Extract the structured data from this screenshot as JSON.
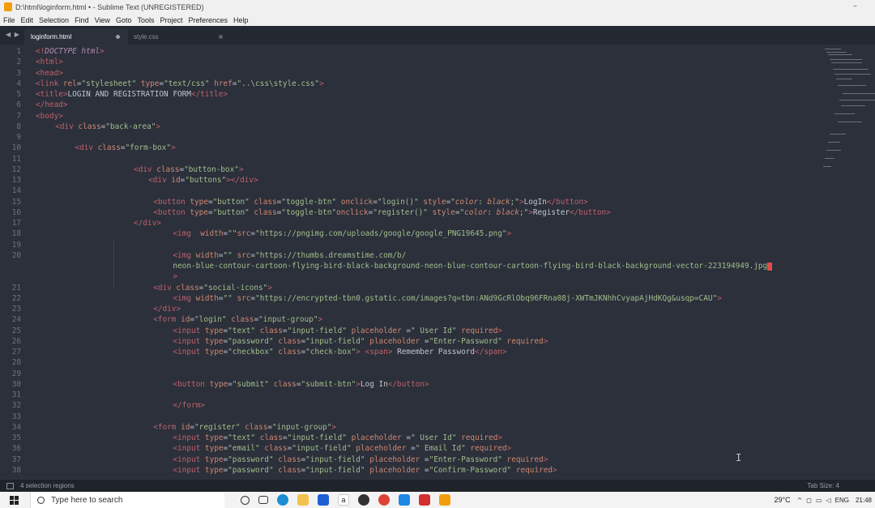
{
  "window": {
    "title": "D:\\html\\loginform.html • - Sublime Text (UNREGISTERED)",
    "minimize_glyph": "–"
  },
  "menu": [
    "File",
    "Edit",
    "Selection",
    "Find",
    "View",
    "Goto",
    "Tools",
    "Project",
    "Preferences",
    "Help"
  ],
  "tabs": [
    {
      "label": "loginform.html",
      "active": true
    },
    {
      "label": "style.css",
      "active": false
    }
  ],
  "nav_arrows": "◀ ▶",
  "editor": {
    "lines": [
      {
        "n": "1",
        "indent": 0,
        "html": "<span class=\"tg\">&lt;!</span><span class=\"kw\">DOCTYPE html</span><span class=\"tg\">&gt;</span>"
      },
      {
        "n": "2",
        "indent": 0,
        "html": "<span class=\"tg\">&lt;html&gt;</span>"
      },
      {
        "n": "3",
        "indent": 0,
        "html": "<span class=\"tg\">&lt;head&gt;</span>"
      },
      {
        "n": "4",
        "indent": 0,
        "html": "<span class=\"tg\">&lt;link</span> <span class=\"at\">rel</span>=<span class=\"st\">\"stylesheet\"</span> <span class=\"at\">type</span>=<span class=\"st\">\"text/css\"</span> <span class=\"at\">href</span>=<span class=\"st\">\"..\\css\\style.css\"</span><span class=\"tg\">&gt;</span>"
      },
      {
        "n": "5",
        "indent": 0,
        "html": "<span class=\"tg\">&lt;title&gt;</span>LOGIN AND REGISTRATION FORM<span class=\"tg\">&lt;/title&gt;</span>"
      },
      {
        "n": "6",
        "indent": 0,
        "html": "<span class=\"tg\">&lt;/head&gt;</span>"
      },
      {
        "n": "7",
        "indent": 0,
        "html": "<span class=\"tg\">&lt;body&gt;</span>"
      },
      {
        "n": "8",
        "indent": 4,
        "html": "<span class=\"tg\">&lt;div</span> <span class=\"at\">class</span>=<span class=\"st\">\"back-area\"</span><span class=\"tg\">&gt;</span>"
      },
      {
        "n": "9",
        "indent": 0,
        "html": ""
      },
      {
        "n": "10",
        "indent": 8,
        "html": "<span class=\"tg\">&lt;div</span> <span class=\"at\">class</span>=<span class=\"st\">\"form-box\"</span><span class=\"tg\">&gt;</span>"
      },
      {
        "n": "11",
        "indent": 0,
        "html": ""
      },
      {
        "n": "12",
        "indent": 20,
        "html": "<span class=\"tg\">&lt;div</span> <span class=\"at\">class</span>=<span class=\"st\">\"button-box\"</span><span class=\"tg\">&gt;</span>"
      },
      {
        "n": "13",
        "indent": 23,
        "html": "<span class=\"tg\">&lt;div</span> <span class=\"at\">id</span>=<span class=\"st\">\"buttons\"</span><span class=\"tg\">&gt;&lt;/div&gt;</span>"
      },
      {
        "n": "14",
        "indent": 0,
        "html": ""
      },
      {
        "n": "15",
        "indent": 24,
        "html": "<span class=\"tg\">&lt;button</span> <span class=\"at\">type</span>=<span class=\"st\">\"button\"</span> <span class=\"at\">class</span>=<span class=\"st\">\"toggle-btn\"</span> <span class=\"at\">onclick</span>=<span class=\"st\">\"login()\"</span> <span class=\"at\">style</span>=<span class=\"st\">\"<span class=\"it\">color</span>: <span class=\"it\">black</span>;\"</span><span class=\"tg\">&gt;</span>LogIn<span class=\"tg\">&lt;/button&gt;</span>"
      },
      {
        "n": "16",
        "indent": 24,
        "html": "<span class=\"tg\">&lt;button</span> <span class=\"at\">type</span>=<span class=\"st\">\"button\"</span> <span class=\"at\">class</span>=<span class=\"st\">\"toggle-btn\"</span><span class=\"at\">onclick</span>=<span class=\"st\">\"register()\"</span> <span class=\"at\">style</span>=<span class=\"st\">\"<span class=\"it\">color</span>: <span class=\"it\">black</span>;\"</span><span class=\"tg\">&gt;</span>Register<span class=\"tg\">&lt;/button&gt;</span>"
      },
      {
        "n": "17",
        "indent": 20,
        "html": "<span class=\"tg\">&lt;/div&gt;</span>"
      },
      {
        "n": "18",
        "indent": 28,
        "html": "<span class=\"tg\">&lt;img</span>  <span class=\"at\">width</span>=<span class=\"st\">\"\"</span><span class=\"at\">src</span>=<span class=\"st\">\"https://pngimg.com/uploads/google/google_PNG19645.png\"</span><span class=\"tg\">&gt;</span>"
      },
      {
        "n": "19",
        "indent": 0,
        "html": ""
      },
      {
        "n": "20",
        "indent": 28,
        "html": "<span class=\"tg\">&lt;img</span> <span class=\"at\">width</span>=<span class=\"st\">\"\"</span> <span class=\"at\">src</span>=<span class=\"st\">\"https://thumbs.dreamstime.com/b/</span>"
      },
      {
        "n": "",
        "indent": 28,
        "html": "<span class=\"st\">neon-blue-contour-cartoon-flying-bird-black-background-neon-blue-contour-cartoon-flying-bird-black-background-vector-223194949.jpg<span class=\"caret\"></span></span>"
      },
      {
        "n": "",
        "indent": 28,
        "html": "<span class=\"tg\">&gt;</span>"
      },
      {
        "n": "21",
        "indent": 24,
        "html": "<span class=\"tg\">&lt;div</span> <span class=\"at\">class</span>=<span class=\"st\">\"social-icons\"</span><span class=\"tg\">&gt;</span>"
      },
      {
        "n": "22",
        "indent": 28,
        "html": "<span class=\"tg\">&lt;img</span> <span class=\"at\">width</span>=<span class=\"st\">\"\"</span> <span class=\"at\">src</span>=<span class=\"st\">\"https://encrypted-tbn0.gstatic.com/images?q=tbn:ANd9GcRlObq96FRna08j-XWTmJKNhhCvyapAjHdKQg&amp;usqp=CAU\"</span><span class=\"tg\">&gt;</span>"
      },
      {
        "n": "23",
        "indent": 24,
        "html": "<span class=\"tg\">&lt;/div&gt;</span>"
      },
      {
        "n": "24",
        "indent": 24,
        "html": "<span class=\"tg\">&lt;form</span> <span class=\"at\">id</span>=<span class=\"st\">\"login\"</span> <span class=\"at\">class</span>=<span class=\"st\">\"input-group\"</span><span class=\"tg\">&gt;</span>"
      },
      {
        "n": "25",
        "indent": 28,
        "html": "<span class=\"tg\">&lt;input</span> <span class=\"at\">type</span>=<span class=\"st\">\"text\"</span> <span class=\"at\">class</span>=<span class=\"st\">\"input-field\"</span> <span class=\"at\">placeholder</span> =<span class=\"st\">\" User Id\"</span> <span class=\"at\">required</span><span class=\"tg\">&gt;</span>"
      },
      {
        "n": "26",
        "indent": 28,
        "html": "<span class=\"tg\">&lt;input</span> <span class=\"at\">type</span>=<span class=\"st\">\"password\"</span> <span class=\"at\">class</span>=<span class=\"st\">\"input-field\"</span> <span class=\"at\">placeholder</span> =<span class=\"st\">\"Enter-Password\"</span> <span class=\"at\">required</span><span class=\"tg\">&gt;</span>"
      },
      {
        "n": "27",
        "indent": 28,
        "html": "<span class=\"tg\">&lt;input</span> <span class=\"at\">type</span>=<span class=\"st\">\"checkbox\"</span> <span class=\"at\">class</span>=<span class=\"st\">\"check-box\"</span><span class=\"tg\">&gt;</span> <span class=\"tg\">&lt;span&gt;</span> Remember Password<span class=\"tg\">&lt;/span&gt;</span>"
      },
      {
        "n": "28",
        "indent": 0,
        "html": ""
      },
      {
        "n": "29",
        "indent": 0,
        "html": ""
      },
      {
        "n": "30",
        "indent": 28,
        "html": "<span class=\"tg\">&lt;button</span> <span class=\"at\">type</span>=<span class=\"st\">\"submit\"</span> <span class=\"at\">class</span>=<span class=\"st\">\"submit-btn\"</span><span class=\"tg\">&gt;</span>Log In<span class=\"tg\">&lt;/button&gt;</span>"
      },
      {
        "n": "31",
        "indent": 0,
        "html": ""
      },
      {
        "n": "32",
        "indent": 28,
        "html": "<span class=\"tg\">&lt;/form&gt;</span>"
      },
      {
        "n": "33",
        "indent": 0,
        "html": ""
      },
      {
        "n": "34",
        "indent": 24,
        "html": "<span class=\"tg\">&lt;form</span> <span class=\"at\">id</span>=<span class=\"st\">\"register\"</span> <span class=\"at\">class</span>=<span class=\"st\">\"input-group\"</span><span class=\"tg\">&gt;</span>"
      },
      {
        "n": "35",
        "indent": 28,
        "html": "<span class=\"tg\">&lt;input</span> <span class=\"at\">type</span>=<span class=\"st\">\"text\"</span> <span class=\"at\">class</span>=<span class=\"st\">\"input-field\"</span> <span class=\"at\">placeholder</span> =<span class=\"st\">\" User Id\"</span> <span class=\"at\">required</span><span class=\"tg\">&gt;</span>"
      },
      {
        "n": "36",
        "indent": 28,
        "html": "<span class=\"tg\">&lt;input</span> <span class=\"at\">type</span>=<span class=\"st\">\"email\"</span> <span class=\"at\">class</span>=<span class=\"st\">\"input-field\"</span> <span class=\"at\">placeholder</span> =<span class=\"st\">\" Email Id\"</span> <span class=\"at\">required</span><span class=\"tg\">&gt;</span>"
      },
      {
        "n": "37",
        "indent": 28,
        "html": "<span class=\"tg\">&lt;input</span> <span class=\"at\">type</span>=<span class=\"st\">\"password\"</span> <span class=\"at\">class</span>=<span class=\"st\">\"input-field\"</span> <span class=\"at\">placeholder</span> =<span class=\"st\">\"Enter-Password\"</span> <span class=\"at\">required</span><span class=\"tg\">&gt;</span>"
      },
      {
        "n": "38",
        "indent": 28,
        "html": "<span class=\"tg\">&lt;input</span> <span class=\"at\">type</span>=<span class=\"st\">\"password\"</span> <span class=\"at\">class</span>=<span class=\"st\">\"input-field\"</span> <span class=\"at\">placeholder</span> =<span class=\"st\">\"Confirm-Password\"</span> <span class=\"at\">required</span><span class=\"tg\">&gt;</span>"
      }
    ]
  },
  "status": {
    "selection": "4 selection regions",
    "tab_size": "Tab Size: 4"
  },
  "taskbar": {
    "search_placeholder": "Type here to search",
    "icons": [
      "cortana-icon",
      "task-view-icon",
      "edge-icon",
      "file-explorer-icon",
      "dropbox-icon",
      "amazon-icon",
      "media-icon",
      "chrome-icon",
      "vscode-icon",
      "acrobat-icon",
      "sublime-icon"
    ],
    "weather": "29°C",
    "language": "ENG",
    "time": "21:48"
  },
  "colors": {
    "editor_bg": "#2b303b",
    "tag": "#bf616a",
    "attribute": "#d08770",
    "string": "#a3be8c",
    "line_number": "#6c7380"
  }
}
